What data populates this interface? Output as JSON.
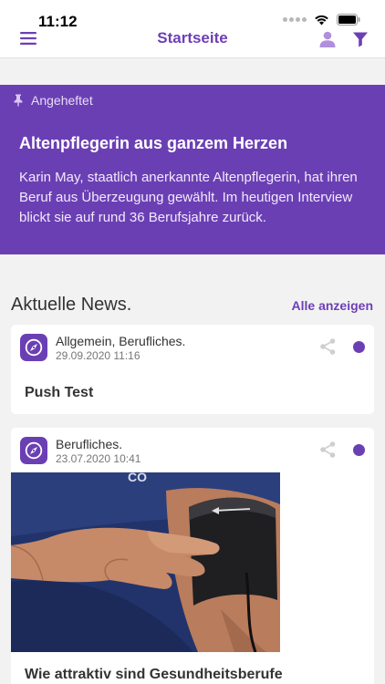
{
  "status_bar": {
    "time": "11:12"
  },
  "nav": {
    "title": "Startseite",
    "icons": [
      "menu-icon",
      "profile-icon",
      "filter-icon"
    ]
  },
  "pinned": {
    "label": "Angeheftet",
    "title": "Altenpflegerin aus ganzem Herzen",
    "text": "Karin May, staatlich anerkannte Altenpflegerin, hat ihren Beruf aus Überzeugung gewählt. Im heutigen Interview blickt sie auf rund 36 Berufsjahre zurück."
  },
  "news": {
    "title": "Aktuelle News.",
    "show_all": "Alle anzeigen",
    "items": [
      {
        "category": "Allgemein, Berufliches.",
        "date": "29.09.2020 11:16",
        "title": "Push Test"
      },
      {
        "category": "Berufliches.",
        "date": "23.07.2020 10:41",
        "title": "Wie attraktiv sind Gesundheitsberufe"
      }
    ]
  },
  "colors": {
    "accent": "#6b3fb4",
    "background": "#f2f2f2",
    "card": "#ffffff"
  }
}
